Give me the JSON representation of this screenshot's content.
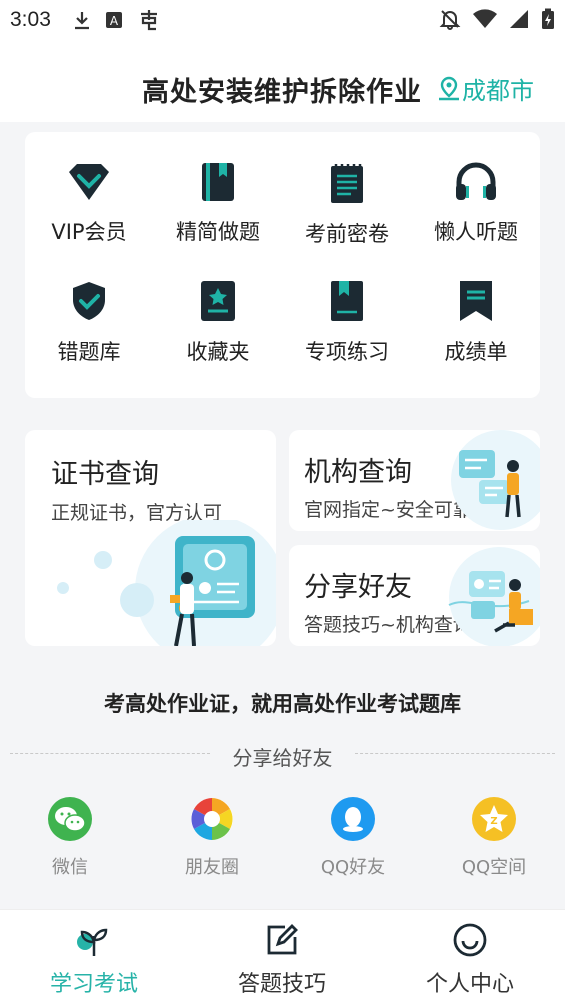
{
  "status_bar": {
    "time": "3:03"
  },
  "header": {
    "title": "高处安装维护拆除作业",
    "location": "成都市"
  },
  "grid": {
    "items": [
      {
        "label": "VIP会员",
        "icon": "vip-diamond-icon"
      },
      {
        "label": "精简做题",
        "icon": "book-icon"
      },
      {
        "label": "考前密卷",
        "icon": "notepad-icon"
      },
      {
        "label": "懒人听题",
        "icon": "headphones-icon"
      },
      {
        "label": "错题库",
        "icon": "shield-check-icon"
      },
      {
        "label": "收藏夹",
        "icon": "star-book-icon"
      },
      {
        "label": "专项练习",
        "icon": "bookmark-book-icon"
      },
      {
        "label": "成绩单",
        "icon": "bookmark-icon"
      }
    ]
  },
  "cards": {
    "certificate": {
      "title": "证书查询",
      "subtitle": "正规证书，官方认可"
    },
    "institution": {
      "title": "机构查询",
      "subtitle": "官网指定~安全可靠"
    },
    "share": {
      "title": "分享好友",
      "subtitle": "答题技巧~机构查询"
    }
  },
  "promo": "考高处作业证，就用高处作业考试题库",
  "share_section": {
    "title": "分享给好友",
    "items": [
      {
        "label": "微信",
        "icon": "wechat-icon",
        "color": "#3fb34f"
      },
      {
        "label": "朋友圈",
        "icon": "moments-icon",
        "color": "#f5a623"
      },
      {
        "label": "QQ好友",
        "icon": "qq-icon",
        "color": "#1e9af0"
      },
      {
        "label": "QQ空间",
        "icon": "qzone-icon",
        "color": "#f5c024"
      }
    ]
  },
  "tabbar": {
    "tabs": [
      {
        "label": "学习考试",
        "active": true
      },
      {
        "label": "答题技巧",
        "active": false
      },
      {
        "label": "个人中心",
        "active": false
      }
    ]
  },
  "colors": {
    "accent": "#1fb3a6",
    "icon_dark": "#1c2a33",
    "background": "#f4f5f7"
  }
}
